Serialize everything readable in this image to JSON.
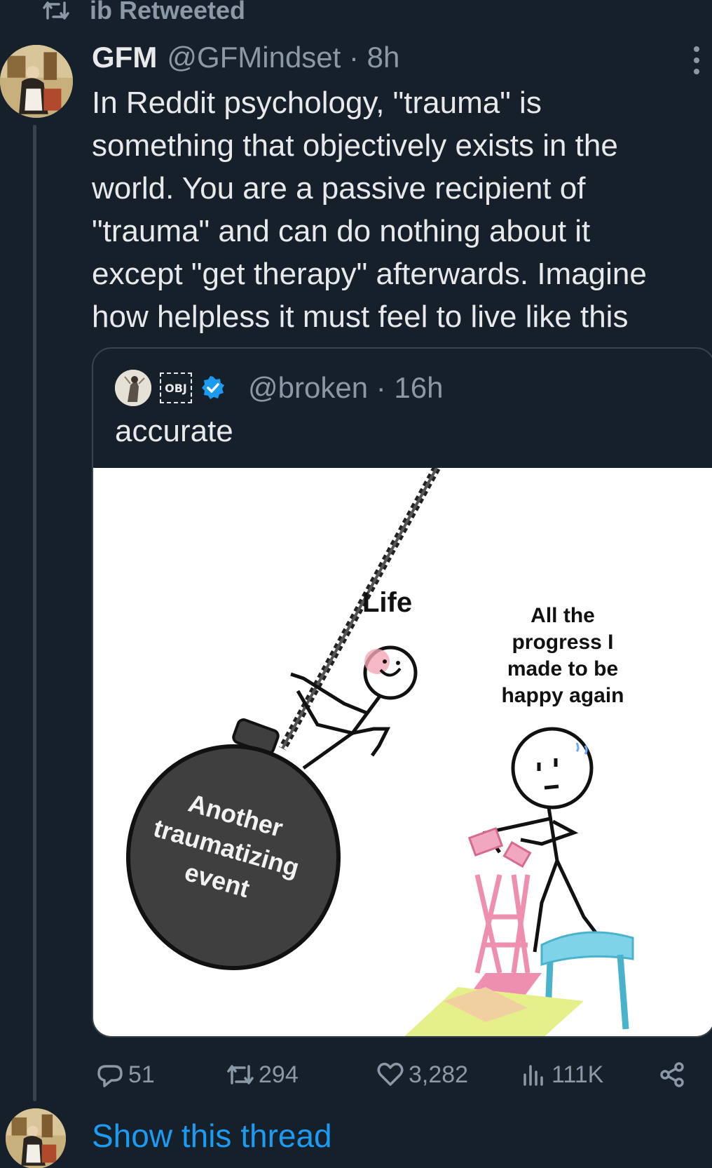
{
  "retweet_banner": {
    "label": "ib Retweeted",
    "icon": "retweet-icon"
  },
  "tweet": {
    "display_name": "GFM",
    "handle_time": "@GFMindset · 8h",
    "text": "In Reddit psychology, \"trauma\" is\nsomething that objectively exists in the\nworld. You are a passive recipient of\n\"trauma\" and can do nothing about it\nexcept \"get therapy\" afterwards. Imagine\nhow helpless it must feel to live like this",
    "more_icon": "more-options-icon"
  },
  "quote": {
    "badge": "OBJ",
    "handle_time": "@broken · 16h",
    "text": "accurate",
    "verified_color": "#1d9bf0",
    "meme_labels": {
      "life": "Life",
      "progress": "All the\nprogress I\nmade to be\nhappy again",
      "ball": "Another\ntraumatizing\nevent"
    }
  },
  "actions": {
    "replies": "51",
    "retweets": "294",
    "likes": "3,282",
    "views": "111K",
    "share_icon": "share-icon"
  },
  "show_thread": "Show this thread",
  "colors": {
    "background": "#15202b",
    "text": "#e7e9ea",
    "secondary": "#8b98a5",
    "accent": "#1d9bf0",
    "border": "#38444d"
  }
}
